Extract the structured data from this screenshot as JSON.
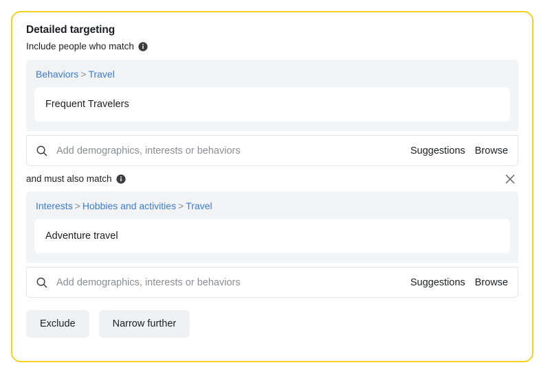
{
  "card": {
    "border_color": "#f5d021",
    "title": "Detailed targeting"
  },
  "include_row": {
    "label": "Include people who match",
    "info_icon": "info-icon"
  },
  "narrow_row": {
    "label": "and must also match",
    "info_icon": "info-icon",
    "close_icon": "close-icon"
  },
  "groups": [
    {
      "breadcrumb": [
        {
          "label": "Behaviors",
          "type": "link"
        },
        {
          "label": ">",
          "type": "separator"
        },
        {
          "label": "Travel",
          "type": "link"
        }
      ],
      "chip": "Frequent Travelers",
      "search": {
        "value": "",
        "placeholder": "Add demographics, interests or behaviors",
        "icon": "search-icon",
        "suggestions_label": "Suggestions",
        "browse_label": "Browse"
      }
    },
    {
      "breadcrumb": [
        {
          "label": "Interests",
          "type": "link"
        },
        {
          "label": ">",
          "type": "separator"
        },
        {
          "label": "Hobbies and activities",
          "type": "link"
        },
        {
          "label": ">",
          "type": "separator"
        },
        {
          "label": "Travel",
          "type": "link"
        }
      ],
      "chip": "Adventure travel",
      "search": {
        "value": "",
        "placeholder": "Add demographics, interests or behaviors",
        "icon": "search-icon",
        "suggestions_label": "Suggestions",
        "browse_label": "Browse"
      }
    }
  ],
  "buttons": {
    "exclude_label": "Exclude",
    "narrow_further_label": "Narrow further"
  },
  "colors": {
    "link": "#3a7bd7",
    "panel_background": "#f2f3f4",
    "text": "#1c1e21",
    "muted_text": "#8a8d91",
    "button_background": "#f0f1f2"
  }
}
